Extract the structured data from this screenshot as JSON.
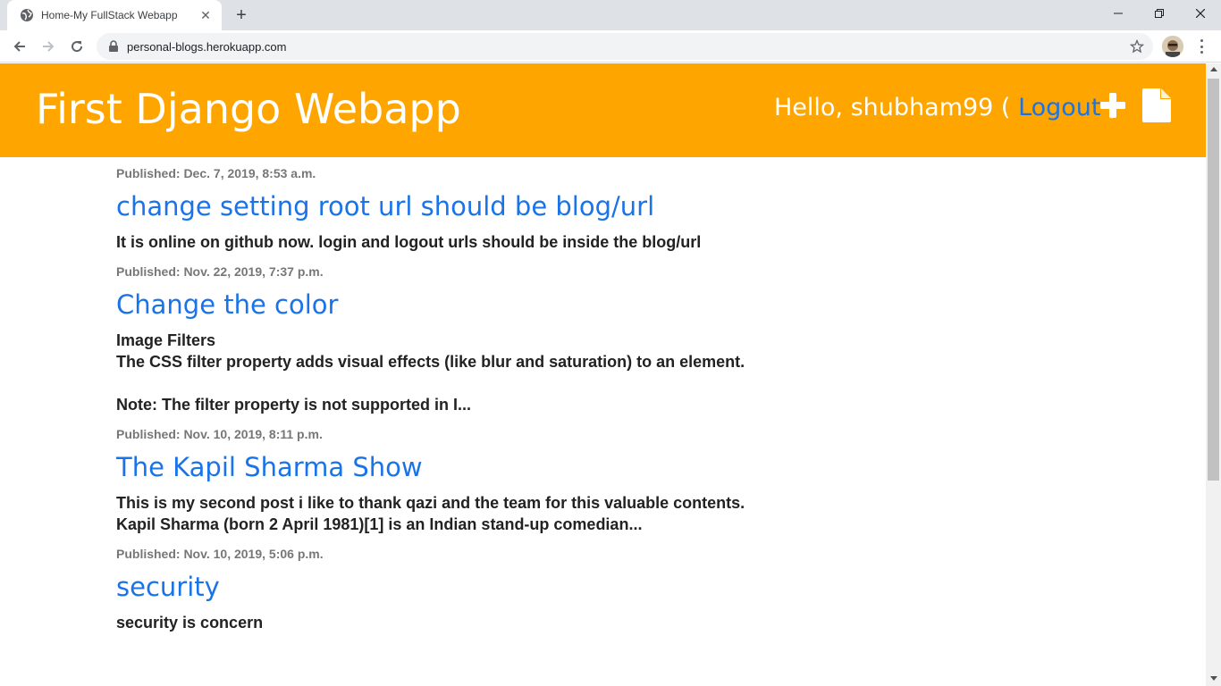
{
  "browser": {
    "tab_title": "Home-My FullStack Webapp",
    "url": "personal-blogs.herokuapp.com"
  },
  "header": {
    "site_title": "First Django Webapp",
    "greeting": "Hello, shubham99 (",
    "logout_label": "Logout",
    "greeting_end": ")",
    "bg_color": "#ffa500",
    "icons": [
      "plus-icon",
      "document-icon"
    ]
  },
  "posts": [
    {
      "date": "Published: Dec. 7, 2019, 8:53 a.m.",
      "title": "change setting root url should be blog/url",
      "body": "It is online on github now. login and logout urls should be inside the blog/url"
    },
    {
      "date": "Published: Nov. 22, 2019, 7:37 p.m.",
      "title": "Change the color",
      "body": "Image Filters\nThe CSS filter property adds visual effects (like blur and saturation) to an element.\n\nNote: The filter property is not supported in I..."
    },
    {
      "date": "Published: Nov. 10, 2019, 8:11 p.m.",
      "title": "The Kapil Sharma Show",
      "body": "This is my second post i like to thank qazi and the team for this valuable contents.\nKapil Sharma (born 2 April 1981)[1] is an Indian stand-up comedian..."
    },
    {
      "date": "Published: Nov. 10, 2019, 5:06 p.m.",
      "title": "security",
      "body": "security is concern"
    }
  ],
  "colors": {
    "link": "#1a73e8",
    "date": "#777777",
    "body": "#222222"
  }
}
